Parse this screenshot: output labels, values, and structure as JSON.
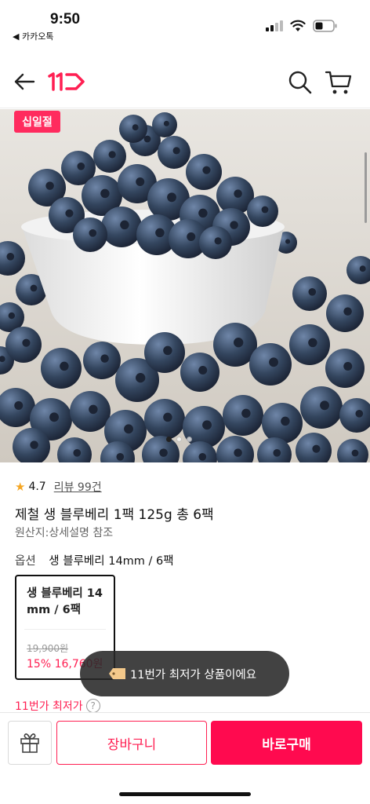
{
  "status": {
    "time": "9:50",
    "back_app": "◀ 카카오톡"
  },
  "header": {
    "logo_text": "11",
    "brand_color": "#ff1f52"
  },
  "hero": {
    "badge": "십일절"
  },
  "product": {
    "rating": "4.7",
    "review_text": "리뷰 99건",
    "title": "제철 생 블루베리 1팩 125g 총 6팩",
    "origin": "원산지:상세설명 참조",
    "option_label": "옵션",
    "option_value": "생 블루베리 14mm / 6팩"
  },
  "option_card": {
    "name": "생 블루베리 14mm / 6팩",
    "original_price": "19,900원",
    "sale_price": "15% 16,760원"
  },
  "lowest_price": {
    "label": "11번가 최저가",
    "help": "?"
  },
  "toast": {
    "text": "11번가 최저가 상품이에요"
  },
  "bottom_bar": {
    "cart_label": "장바구니",
    "buy_label": "바로구매",
    "accent": "#ff0a4f"
  },
  "icons": [
    "back-arrow-icon",
    "search-icon",
    "cart-icon",
    "gift-icon",
    "star-icon",
    "price-tag-icon",
    "signal-icon",
    "wifi-icon",
    "battery-icon"
  ]
}
